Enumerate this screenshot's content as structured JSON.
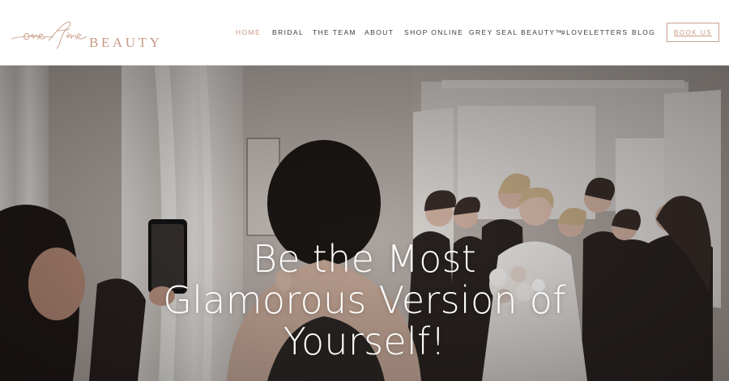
{
  "brand": {
    "logo_text": "oneFine BEAUTY",
    "accent_color": "#c79a86"
  },
  "nav": {
    "items": [
      {
        "label": "HOME",
        "active": true
      },
      {
        "label": "BRIDAL",
        "active": false
      },
      {
        "label": "THE TEAM",
        "active": false
      },
      {
        "label": "ABOUT",
        "active": false
      },
      {
        "label": "SHOP ONLINE",
        "active": false
      },
      {
        "label": "GREY SEAL BEAUTY™",
        "active": false
      },
      {
        "label": "#LOVELETTERS",
        "active": false
      },
      {
        "label": "BLOG",
        "active": false
      }
    ],
    "cta_label": "BOOK US"
  },
  "hero": {
    "title_lines": [
      "Be the Most",
      "Glamorous Version of",
      "Yourself!"
    ],
    "image_subject": "bridal-party-photo"
  }
}
